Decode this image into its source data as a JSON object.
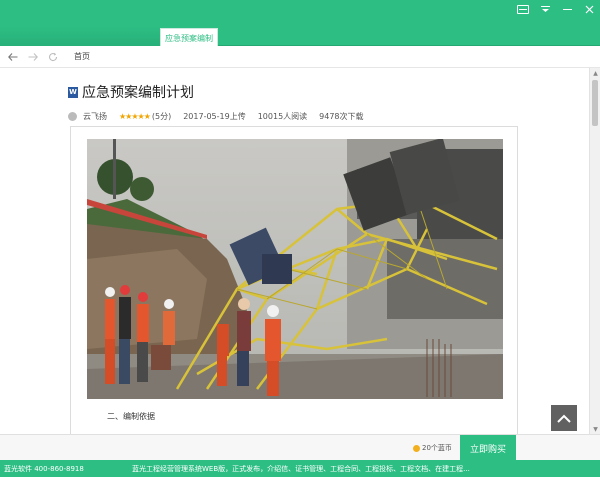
{
  "tabs": [
    {
      "label": "应急预案编制",
      "active": true
    }
  ],
  "nav": {
    "breadcrumb": "首页"
  },
  "document": {
    "title": "应急预案编制计划",
    "author": "云飞扬",
    "stars": "★★★★★",
    "rating": "(5分)",
    "uploaded": "2017-05-19上传",
    "reads": "10015人阅读",
    "downloads": "9478次下载",
    "first_section": "二、编制依据"
  },
  "purchase": {
    "price": "20个蓝币",
    "buy_label": "立即购买"
  },
  "footer": {
    "contact": "蓝光软件 400-860-8918",
    "ticker": "蓝光工程经营管理系统WEB版，正式发布，介绍信、证书管理、工程合同、工程投标、工程文档、在建工程..."
  },
  "colors": {
    "brand": "#2dbe84",
    "star": "#f2a500"
  },
  "icons": {
    "back": "back-arrow-icon",
    "forward": "forward-arrow-icon",
    "refresh": "refresh-icon",
    "word": "word-document-icon",
    "to_top": "chevron-up-icon"
  }
}
